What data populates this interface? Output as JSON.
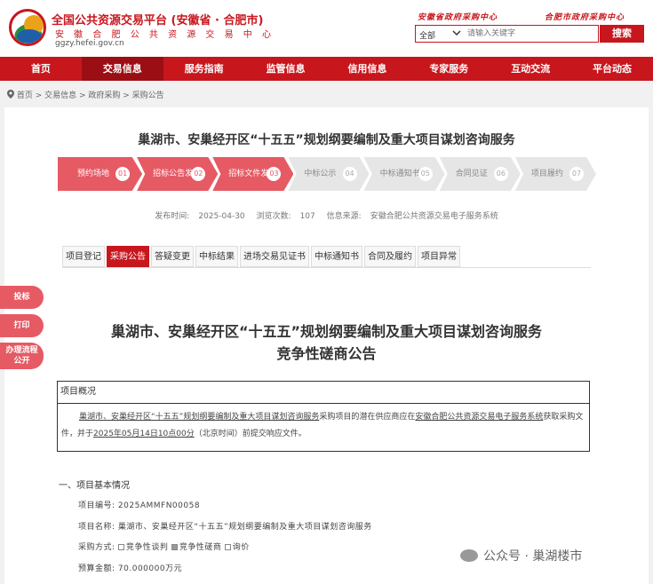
{
  "header": {
    "title": "全国公共资源交易平台 (安徽省 · 合肥市)",
    "subtitle": "安 徽 合 肥 公 共 资 源 交 易 中 心",
    "url": "ggzy.hefei.gov.cn",
    "link1": "安徽省政府采购中心",
    "link2": "合肥市政府采购中心",
    "search_category": "全部",
    "search_placeholder": "请输入关键字",
    "search_button": "搜索"
  },
  "nav": [
    "首页",
    "交易信息",
    "服务指南",
    "监管信息",
    "信用信息",
    "专家服务",
    "互动交流",
    "平台动态"
  ],
  "nav_active_index": 1,
  "breadcrumb": "首页 > 交易信息 > 政府采购 > 采购公告",
  "main_title": "巢湖市、安巢经开区“十五五”规划纲要编制及重大项目谋划咨询服务",
  "steps": [
    {
      "label": "预约场地",
      "num": "01",
      "done": true
    },
    {
      "label": "招标公告发布",
      "num": "02",
      "done": true
    },
    {
      "label": "招标文件发布",
      "num": "03",
      "done": true
    },
    {
      "label": "中标公示",
      "num": "04",
      "done": false
    },
    {
      "label": "中标通知书",
      "num": "05",
      "done": false
    },
    {
      "label": "合同见证",
      "num": "06",
      "done": false
    },
    {
      "label": "项目履约",
      "num": "07",
      "done": false
    }
  ],
  "meta": {
    "publish_label": "发布时间:",
    "publish_date": "2025-04-30",
    "views_label": "浏览次数:",
    "views": "107",
    "source_label": "信息来源:",
    "source": "安徽合肥公共资源交易电子服务系统"
  },
  "tabs": [
    "项目登记",
    "采购公告",
    "答疑变更",
    "中标结果",
    "进场交易见证书",
    "中标通知书",
    "合同及履约",
    "项目异常"
  ],
  "tab_active_index": 1,
  "side_buttons": [
    "投标",
    "打印",
    "办理流程公开"
  ],
  "doc_title_line1": "巢湖市、安巢经开区“十五五”规划纲要编制及重大项目谋划咨询服务",
  "doc_title_line2": "竞争性磋商公告",
  "overview": {
    "head": "项目概况",
    "p1": "巢湖市、安巢经开区“十五五”规划纲要编制及重大项目谋划咨询服务",
    "p2": "采购项目的潜在供应商应在",
    "p3": "安徽合肥公共资源交易电子服务系统",
    "p4": "获取采购文件，并于",
    "p5": "2025年05月14日10点00分",
    "p6": "（北京时间）前提交响应文件。"
  },
  "section1": {
    "title": "一、项目基本情况",
    "rows": [
      {
        "label": "项目编号:",
        "value": "2025AMMFN00058"
      },
      {
        "label": "项目名称:",
        "value": "巢湖市、安巢经开区“十五五”规划纲要编制及重大项目谋划咨询服务"
      },
      {
        "label": "采购方式:",
        "options": [
          "竞争性谈判",
          "竞争性磋商",
          "询价"
        ],
        "checked_index": 1
      },
      {
        "label": "预算金额:",
        "value": "70.000000万元"
      }
    ]
  },
  "watermark": "公众号 · 巢湖楼市",
  "colors": {
    "brand": "#c8161d",
    "step_done": "#e65a64",
    "nav_active": "#9b0f14"
  }
}
